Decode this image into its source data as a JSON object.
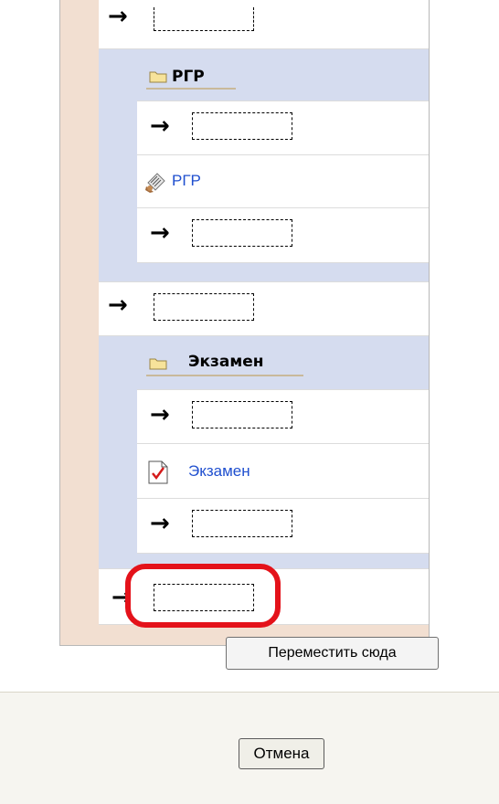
{
  "items": {
    "section1_title": "РГР",
    "section1_resource": "РГР",
    "section2_title": "Экзамен",
    "section2_resource": "Экзамен"
  },
  "icons": {
    "arrow": "→",
    "folder": "folder-icon",
    "assignment": "assignment-icon",
    "quiz": "quiz-icon"
  },
  "actions": {
    "move_here_label": "Переместить сюда",
    "cancel_label": "Отмена"
  },
  "colors": {
    "section_bg": "#d5dcef",
    "left_strip": "#f2dfd1",
    "link": "#1f4fcf",
    "highlight": "#e4121a"
  }
}
